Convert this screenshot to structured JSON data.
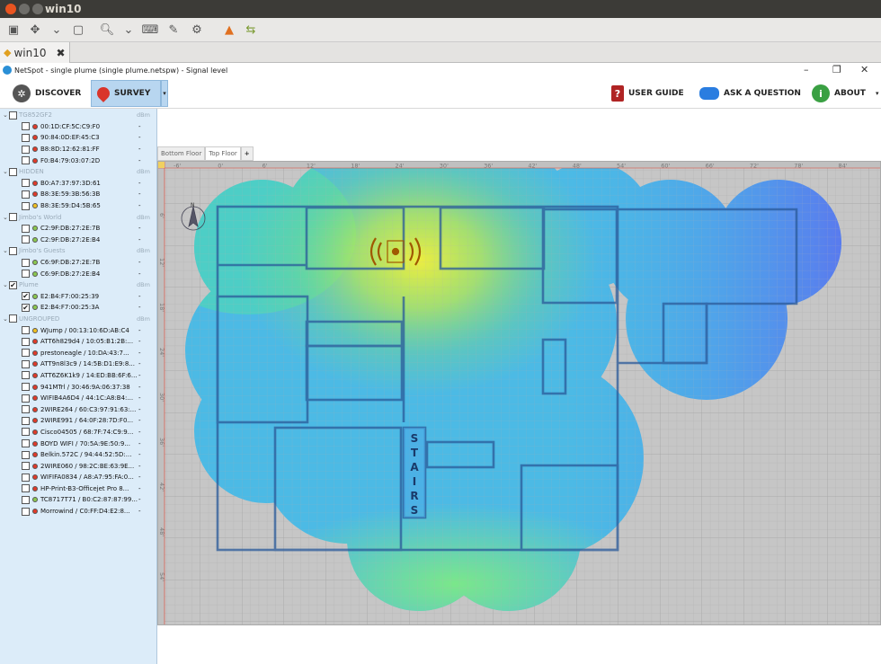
{
  "vm": {
    "title": "win10",
    "tab_label": "win10"
  },
  "app": {
    "title": "NetSpot - single plume (single plume.netspw) - Signal level"
  },
  "toolbar": {
    "discover": "DISCOVER",
    "survey": "SURVEY",
    "user_guide": "USER GUIDE",
    "ask_question": "ASK A QUESTION",
    "about": "ABOUT"
  },
  "sidebar": {
    "groups": [
      {
        "name": "TG852GF2",
        "checked": false,
        "dbm": "dBm",
        "items": [
          {
            "label": "00:1D:CF:5C:C9:F0",
            "signal": "-",
            "checked": false,
            "color": "#e03a2a"
          },
          {
            "label": "90:84:0D:EF:45:C3",
            "signal": "-",
            "checked": false,
            "color": "#e03a2a"
          },
          {
            "label": "B8:8D:12:62:81:FF",
            "signal": "-",
            "checked": false,
            "color": "#e03a2a"
          },
          {
            "label": "F0:B4:79:03:07:2D",
            "signal": "-",
            "checked": false,
            "color": "#e03a2a"
          }
        ]
      },
      {
        "name": "HIDDEN",
        "checked": false,
        "dbm": "dBm",
        "items": [
          {
            "label": "B0:A7:37:97:3D:61",
            "signal": "-",
            "checked": false,
            "color": "#e03a2a"
          },
          {
            "label": "B8:3E:59:3B:56:3B",
            "signal": "-",
            "checked": false,
            "color": "#e03a2a"
          },
          {
            "label": "B8:3E:59:D4:5B:65",
            "signal": "-",
            "checked": false,
            "color": "#f0c020"
          }
        ]
      },
      {
        "name": "Jimbo's World",
        "checked": false,
        "dbm": "dBm",
        "items": [
          {
            "label": "C2:9F:DB:27:2E:7B",
            "signal": "-",
            "checked": false,
            "color": "#8ac850"
          },
          {
            "label": "C2:9F:DB:27:2E:B4",
            "signal": "-",
            "checked": false,
            "color": "#8ac850"
          }
        ]
      },
      {
        "name": "Jimbo's Guests",
        "checked": false,
        "dbm": "dBm",
        "items": [
          {
            "label": "C6:9F:DB:27:2E:7B",
            "signal": "-",
            "checked": false,
            "color": "#8ac850"
          },
          {
            "label": "C6:9F:DB:27:2E:B4",
            "signal": "-",
            "checked": false,
            "color": "#8ac850"
          }
        ]
      },
      {
        "name": "Plume",
        "checked": true,
        "dbm": "dBm",
        "items": [
          {
            "label": "E2:B4:F7:00:25:39",
            "signal": "-",
            "checked": true,
            "color": "#8ac850"
          },
          {
            "label": "E2:B4:F7:00:25:3A",
            "signal": "-",
            "checked": true,
            "color": "#8ac850"
          }
        ]
      },
      {
        "name": "UNGROUPED",
        "checked": false,
        "dbm": "dBm",
        "items": [
          {
            "label": "WJump / 00:13:10:6D:AB:C4",
            "signal": "-",
            "checked": false,
            "color": "#f0c020"
          },
          {
            "label": "ATT6h829d4 / 10:05:B1:2B:...",
            "signal": "-",
            "checked": false,
            "color": "#e03a2a"
          },
          {
            "label": "prestoneagle / 10:DA:43:7...",
            "signal": "-",
            "checked": false,
            "color": "#e03a2a"
          },
          {
            "label": "ATT9n8l3c9 / 14:5B:D1:E9:8...",
            "signal": "-",
            "checked": false,
            "color": "#e03a2a"
          },
          {
            "label": "ATT6Z6K1k9 / 14:ED:BB:6F:6...",
            "signal": "-",
            "checked": false,
            "color": "#e03a2a"
          },
          {
            "label": "941MTrl / 30:46:9A:06:37:38",
            "signal": "-",
            "checked": false,
            "color": "#e03a2a"
          },
          {
            "label": "WIFIB4A6D4 / 44:1C:A8:B4:...",
            "signal": "-",
            "checked": false,
            "color": "#e03a2a"
          },
          {
            "label": "2WIRE264 / 60:C3:97:91:63:...",
            "signal": "-",
            "checked": false,
            "color": "#e03a2a"
          },
          {
            "label": "2WIRE991 / 64:0F:28:7D:F0...",
            "signal": "-",
            "checked": false,
            "color": "#e03a2a"
          },
          {
            "label": "Cisco04505 / 68:7F:74:C9:9...",
            "signal": "-",
            "checked": false,
            "color": "#e03a2a"
          },
          {
            "label": "BOYD WIFI / 70:5A:9E:50:9...",
            "signal": "-",
            "checked": false,
            "color": "#e03a2a"
          },
          {
            "label": "Belkin.572C / 94:44:52:5D:...",
            "signal": "-",
            "checked": false,
            "color": "#e03a2a"
          },
          {
            "label": "2WIRE060 / 98:2C:BE:63:9E...",
            "signal": "-",
            "checked": false,
            "color": "#e03a2a"
          },
          {
            "label": "WIFIFA0834 / A8:A7:95:FA:0...",
            "signal": "-",
            "checked": false,
            "color": "#e03a2a"
          },
          {
            "label": "HP-Print-B3-Officejet Pro 8...",
            "signal": "-",
            "checked": false,
            "color": "#e03a2a"
          },
          {
            "label": "TC8717T71 / B0:C2:87:87:99...",
            "signal": "-",
            "checked": false,
            "color": "#8ac850"
          },
          {
            "label": "Morrowind / C0:FF:D4:E2:8...",
            "signal": "-",
            "checked": false,
            "color": "#e03a2a"
          }
        ]
      }
    ]
  },
  "floors": {
    "tabs": [
      "Bottom Floor",
      "Top Floor"
    ],
    "active": "Top Floor",
    "add": "+"
  },
  "ruler": {
    "top": [
      "-6'",
      "0'",
      "6'",
      "12'",
      "18'",
      "24'",
      "30'",
      "36'",
      "42'",
      "48'",
      "54'",
      "60'",
      "66'",
      "72'",
      "78'",
      "84'"
    ],
    "left": [
      "6'",
      "12'",
      "18'",
      "24'",
      "30'",
      "36'",
      "42'",
      "48'",
      "54'"
    ]
  },
  "plan": {
    "stairs_letters": [
      "S",
      "T",
      "A",
      "I",
      "R",
      "S"
    ],
    "north": "N"
  }
}
